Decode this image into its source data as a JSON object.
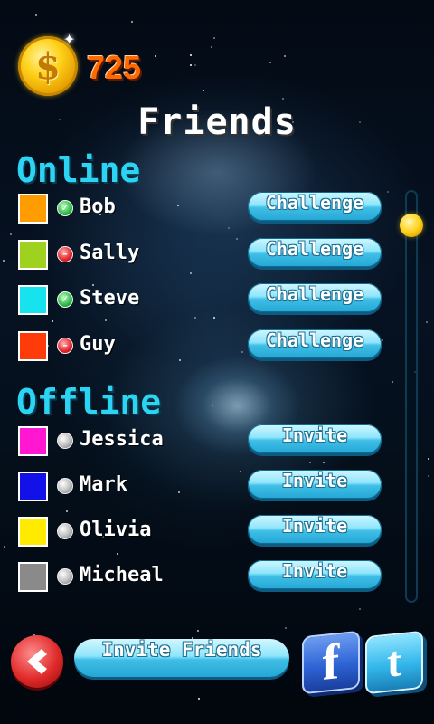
{
  "header": {
    "coins": "725",
    "title": "Friends"
  },
  "sections": {
    "online": "Online",
    "offline": "Offline"
  },
  "online_friends": [
    {
      "name": "Bob",
      "color": "#ff9d00",
      "status": "online",
      "action": "Challenge"
    },
    {
      "name": "Sally",
      "color": "#9fd21e",
      "status": "busy",
      "action": "Challenge"
    },
    {
      "name": "Steve",
      "color": "#17e3ef",
      "status": "online",
      "action": "Challenge"
    },
    {
      "name": "Guy",
      "color": "#ff3b0a",
      "status": "busy",
      "action": "Challenge"
    }
  ],
  "offline_friends": [
    {
      "name": "Jessica",
      "color": "#ff17d1",
      "status": "offline",
      "action": "Invite"
    },
    {
      "name": "Mark",
      "color": "#1212e8",
      "status": "offline",
      "action": "Invite"
    },
    {
      "name": "Olivia",
      "color": "#ffea00",
      "status": "offline",
      "action": "Invite"
    },
    {
      "name": "Micheal",
      "color": "#8a8a8a",
      "status": "offline",
      "action": "Invite"
    }
  ],
  "footer": {
    "invite_label": "Invite Friends",
    "facebook_glyph": "f",
    "twitter_glyph": "t"
  },
  "icons": {
    "coin": "coin-icon",
    "back": "back-arrow-icon",
    "facebook": "facebook-icon",
    "twitter": "twitter-icon"
  }
}
